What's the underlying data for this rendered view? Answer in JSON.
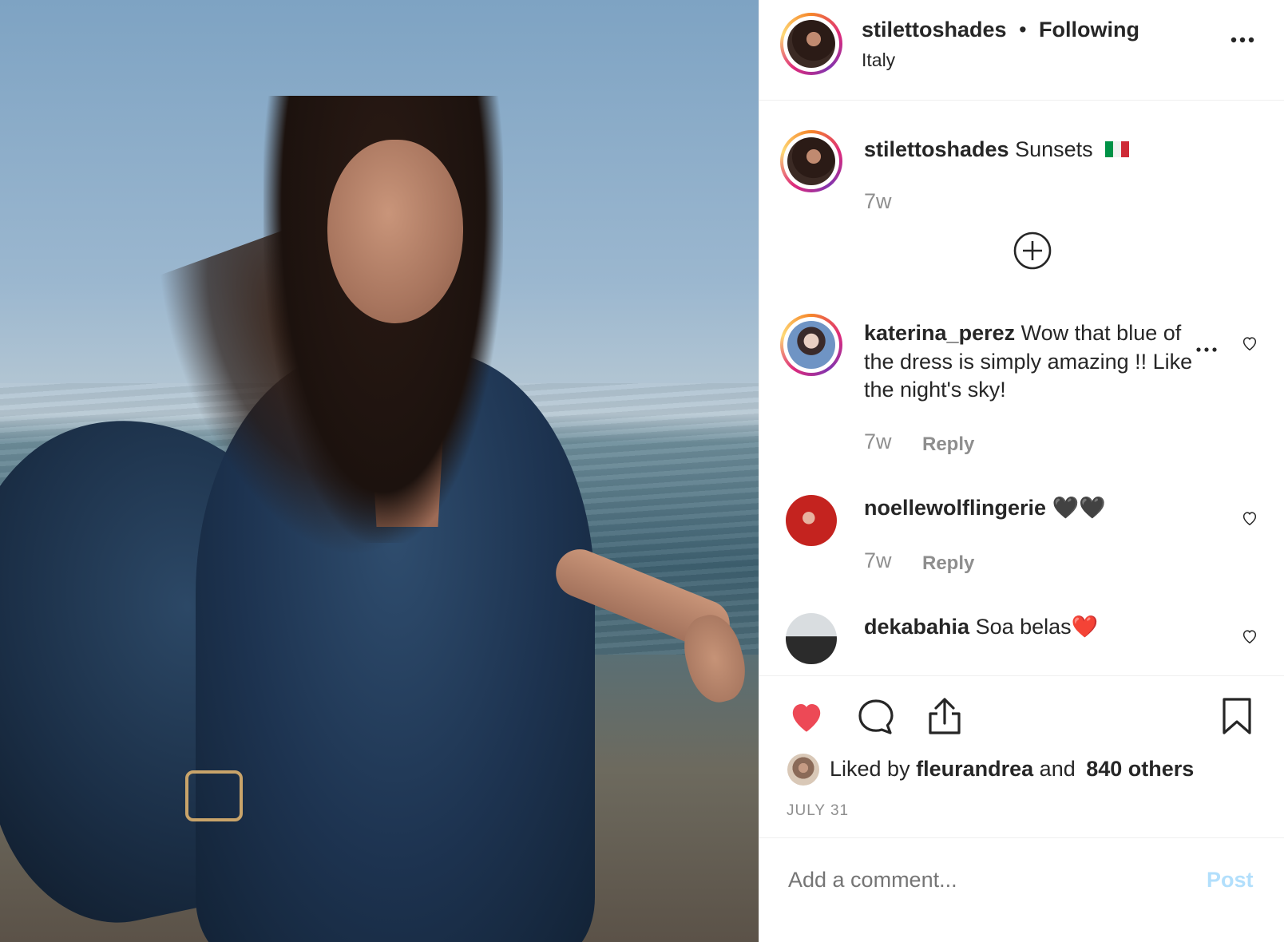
{
  "header": {
    "username": "stilettoshades",
    "separator": "•",
    "follow_status": "Following",
    "location": "Italy",
    "more_icon": "more-horizontal-icon"
  },
  "caption": {
    "username": "stilettoshades",
    "text": "Sunsets",
    "flag_icon": "italy-flag-icon",
    "time": "7w"
  },
  "load_more_icon": "plus-circle-icon",
  "comments": [
    {
      "username": "katerina_perez",
      "text_line1": "Wow that blue of",
      "text_line2": "the dress is simply amazing !! Like",
      "text_line3": "the night's sky!",
      "time": "7w",
      "reply_label": "Reply",
      "more_icon": "more-horizontal-icon",
      "like_icon": "heart-outline-icon"
    },
    {
      "username": "noellewolflingerie",
      "emoji": "🖤🖤",
      "time": "7w",
      "reply_label": "Reply",
      "like_icon": "heart-outline-icon"
    },
    {
      "username": "dekabahia",
      "text": "Soa belas",
      "emoji": "❤️",
      "like_icon": "heart-outline-icon"
    }
  ],
  "actions": {
    "like_icon": "heart-filled-icon",
    "comment_icon": "comment-bubble-icon",
    "share_icon": "share-upload-icon",
    "save_icon": "bookmark-icon",
    "like_color": "#ed4956"
  },
  "likes": {
    "prefix": "Liked by",
    "user": "fleurandrea",
    "conjunction": "and",
    "others": "840 others"
  },
  "date": "JULY 31",
  "comment_box": {
    "placeholder": "Add a comment...",
    "post_label": "Post",
    "post_color": "#b2dffc"
  }
}
